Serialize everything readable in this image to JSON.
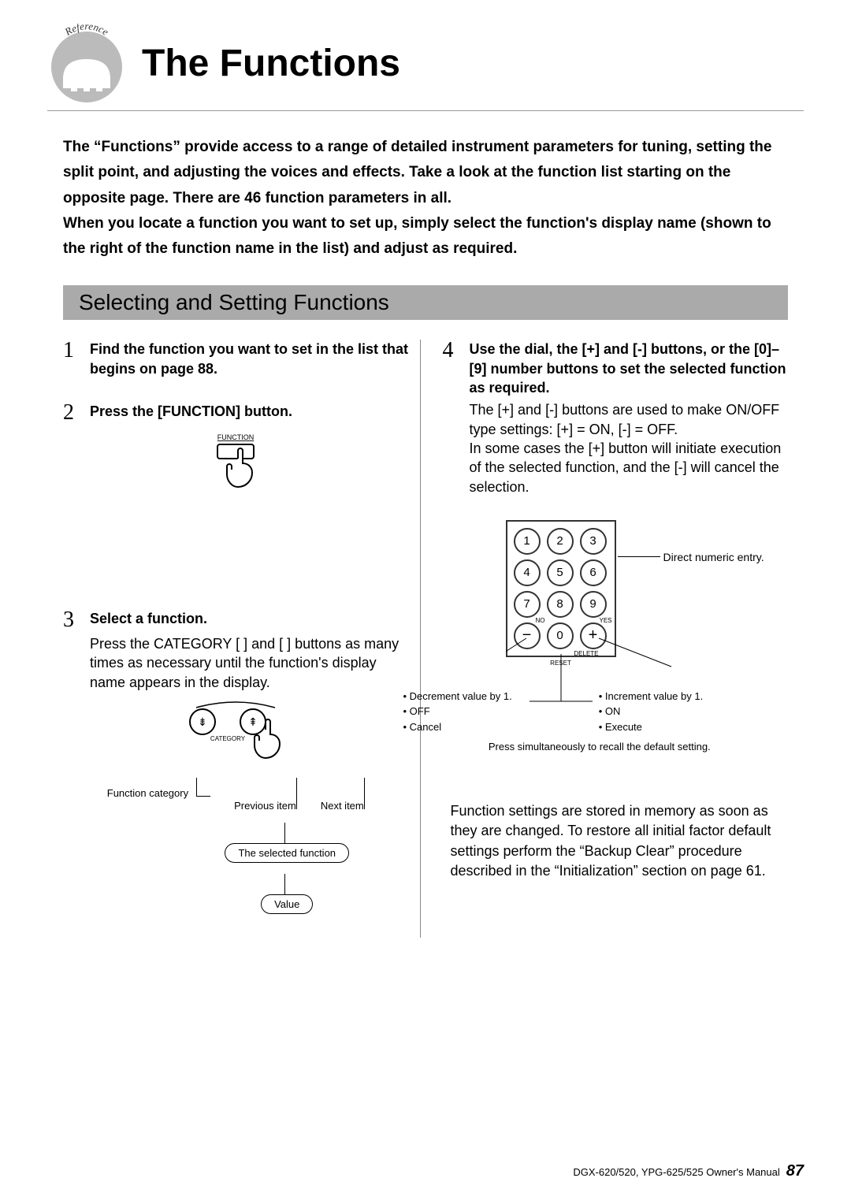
{
  "header": {
    "badge_label": "Reference",
    "title": "The Functions"
  },
  "intro": "The “Functions” provide access to a range of detailed instrument parameters for tuning, setting the split point, and adjusting the voices and effects. Take a look at the function list starting on the opposite page. There are 46 function parameters in all.\nWhen you locate a function you want to set up, simply select the function's display name (shown to the right of the function name in the list) and adjust as required.",
  "section_title": "Selecting and Setting Functions",
  "steps": {
    "s1": {
      "num": "1",
      "title": "Find the function you want to set in the list that begins on page 88."
    },
    "s2": {
      "num": "2",
      "title": "Press the [FUNCTION] button.",
      "btn_label": "FUNCTION"
    },
    "s3": {
      "num": "3",
      "title": "Select a function.",
      "body": "Press the CATEGORY [ ] and [ ] buttons as many times as necessary until the function's display name appears in the display.",
      "cat_label": "CATEGORY",
      "lab_category": "Function category",
      "lab_prev": "Previous item",
      "lab_next": "Next item",
      "pill_selected": "The selected function",
      "pill_value": "Value"
    },
    "s4": {
      "num": "4",
      "title": "Use the dial, the [+] and [-] buttons, or the [0]–[9] number buttons to set the selected function as required.",
      "body": "The [+] and [-] buttons are used to make ON/OFF type settings: [+] = ON, [-] = OFF.\nIn some cases the [+] button will initiate execution of the selected function, and the [-] will cancel the selection.",
      "direct_entry": "Direct numeric entry.",
      "no": "NO",
      "yes": "YES",
      "delete": "DELETE",
      "reset": "RESET",
      "dec_title": "Decrement value by 1.",
      "dec_off": "OFF",
      "dec_cancel": "Cancel",
      "inc_title": "Increment value by 1.",
      "inc_on": "ON",
      "inc_exec": "Execute",
      "sim_note": "Press simultaneously to recall the default setting."
    }
  },
  "keypad": [
    "1",
    "2",
    "3",
    "4",
    "5",
    "6",
    "7",
    "8",
    "9",
    "−",
    "0",
    "+"
  ],
  "memory_note": "Function settings are stored in memory as soon as they are changed. To restore all initial factor default settings perform the “Backup Clear” procedure described in the “Initialization” section on page 61.",
  "footer": {
    "manual": "DGX-620/520, YPG-625/525  Owner's Manual",
    "page": "87"
  }
}
